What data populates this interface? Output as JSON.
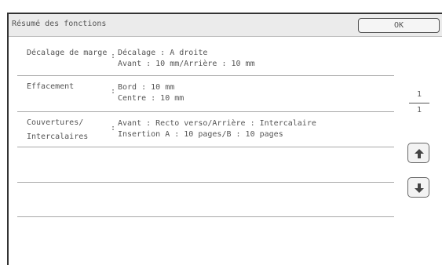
{
  "header": {
    "title": "Résumé des fonctions",
    "ok_label": "OK"
  },
  "functions": [
    {
      "label": "Décalage de marge",
      "values": [
        "Décalage : A droite",
        "Avant : 10 mm/Arrière : 10 mm"
      ]
    },
    {
      "label": "Effacement",
      "values": [
        "Bord : 10 mm",
        "Centre : 10 mm"
      ]
    },
    {
      "label": [
        "Couvertures/",
        "Intercalaires"
      ],
      "values": [
        "Avant : Recto verso/Arrière : Intercalaire",
        "Insertion A : 10 pages/B : 10 pages"
      ]
    }
  ],
  "pager": {
    "current": "1",
    "total": "1"
  },
  "icons": {
    "up": "arrow-up-icon",
    "down": "arrow-down-icon"
  },
  "colors": {
    "text": "#555555",
    "separator": "#a8a8a8",
    "titlebar": "#ebebeb"
  }
}
